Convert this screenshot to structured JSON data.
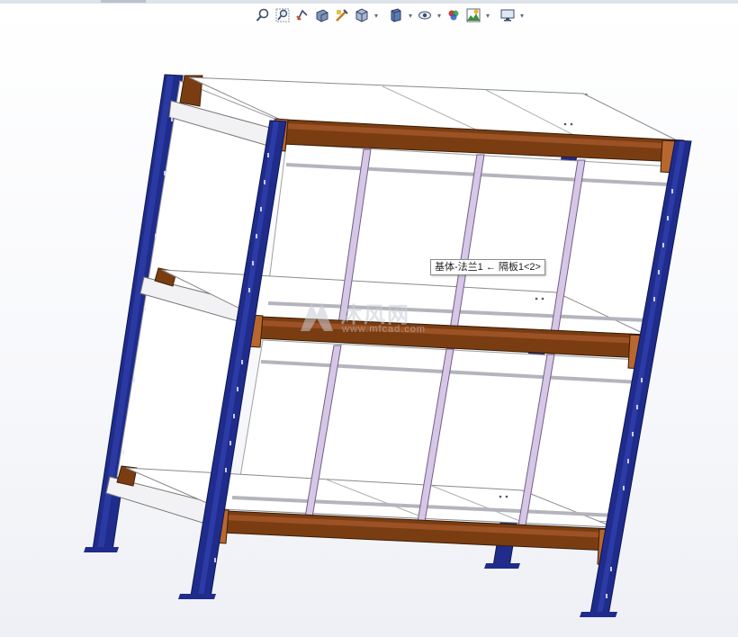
{
  "toolbar": {
    "items": [
      {
        "icon": "zoom-to-fit-icon"
      },
      {
        "icon": "zoom-to-area-icon"
      },
      {
        "icon": "previous-view-icon"
      },
      {
        "icon": "section-view-icon"
      },
      {
        "icon": "dynamic-annotation-icon"
      },
      {
        "icon": "view-orientation-icon",
        "dropdown": true
      },
      {
        "icon": "display-style-icon",
        "dropdown": true
      },
      {
        "icon": "hide-show-items-icon",
        "dropdown": true
      },
      {
        "icon": "edit-appearance-icon",
        "dropdown": false
      },
      {
        "icon": "apply-scene-icon",
        "dropdown": true
      },
      {
        "icon": "view-settings-icon",
        "dropdown": true
      }
    ]
  },
  "tooltip": {
    "text": "基体-法兰1 ← 隔板1<2>"
  },
  "watermark": {
    "brand": "沐风网",
    "url": "www.mfcad.com"
  },
  "colors": {
    "upright": "#1f2c8c",
    "beam": "#7a3d12",
    "divider": "#c9b8d8",
    "rod": "#b4b4bc",
    "panel": "#ffffff"
  }
}
